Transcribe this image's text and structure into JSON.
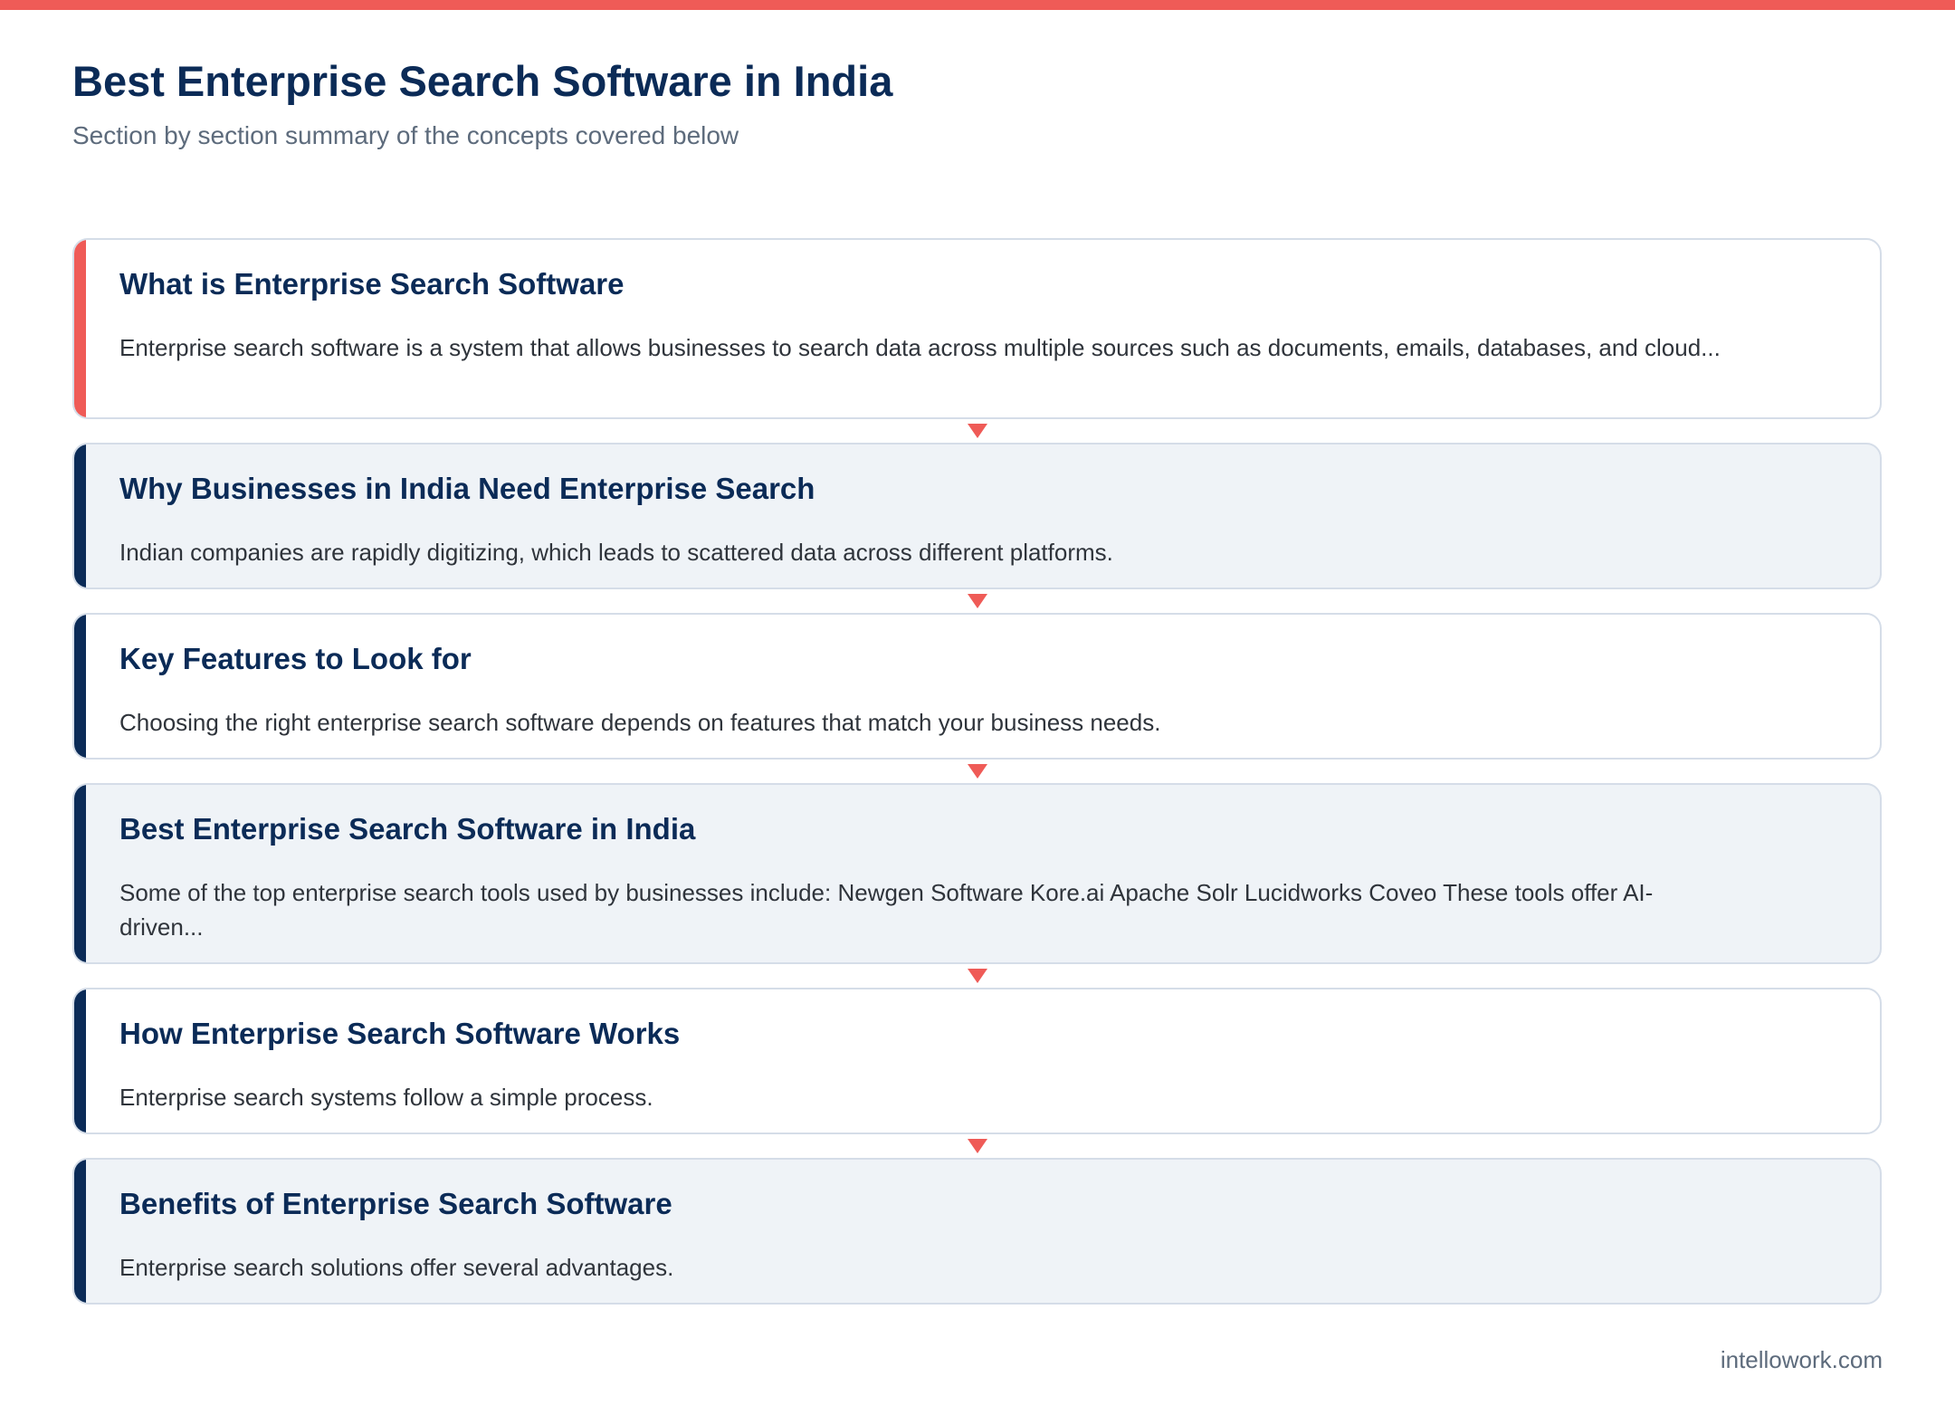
{
  "colors": {
    "accent_red": "#ef5b57",
    "navy": "#0b2b57"
  },
  "page": {
    "title": "Best Enterprise Search Software in India",
    "subtitle": "Section by section summary of the concepts covered below"
  },
  "sections": [
    {
      "title": "What is Enterprise Search Software",
      "text": "Enterprise search software is a system that allows businesses to search data across multiple sources such as documents, emails, databases, and cloud..."
    },
    {
      "title": "Why Businesses in India Need Enterprise Search",
      "text": "Indian companies are rapidly digitizing, which leads to scattered data across different platforms."
    },
    {
      "title": "Key Features to Look for",
      "text": "Choosing the right enterprise search software depends on features that match your business needs."
    },
    {
      "title": "Best Enterprise Search Software in India",
      "text": "Some of the top enterprise search tools used by businesses include: Newgen Software Kore.ai Apache Solr Lucidworks Coveo These tools offer AI-driven..."
    },
    {
      "title": "How Enterprise Search Software Works",
      "text": "Enterprise search systems follow a simple process."
    },
    {
      "title": "Benefits of Enterprise Search Software",
      "text": "Enterprise search solutions offer several advantages."
    }
  ],
  "footer": {
    "site": "intellowork.com"
  }
}
